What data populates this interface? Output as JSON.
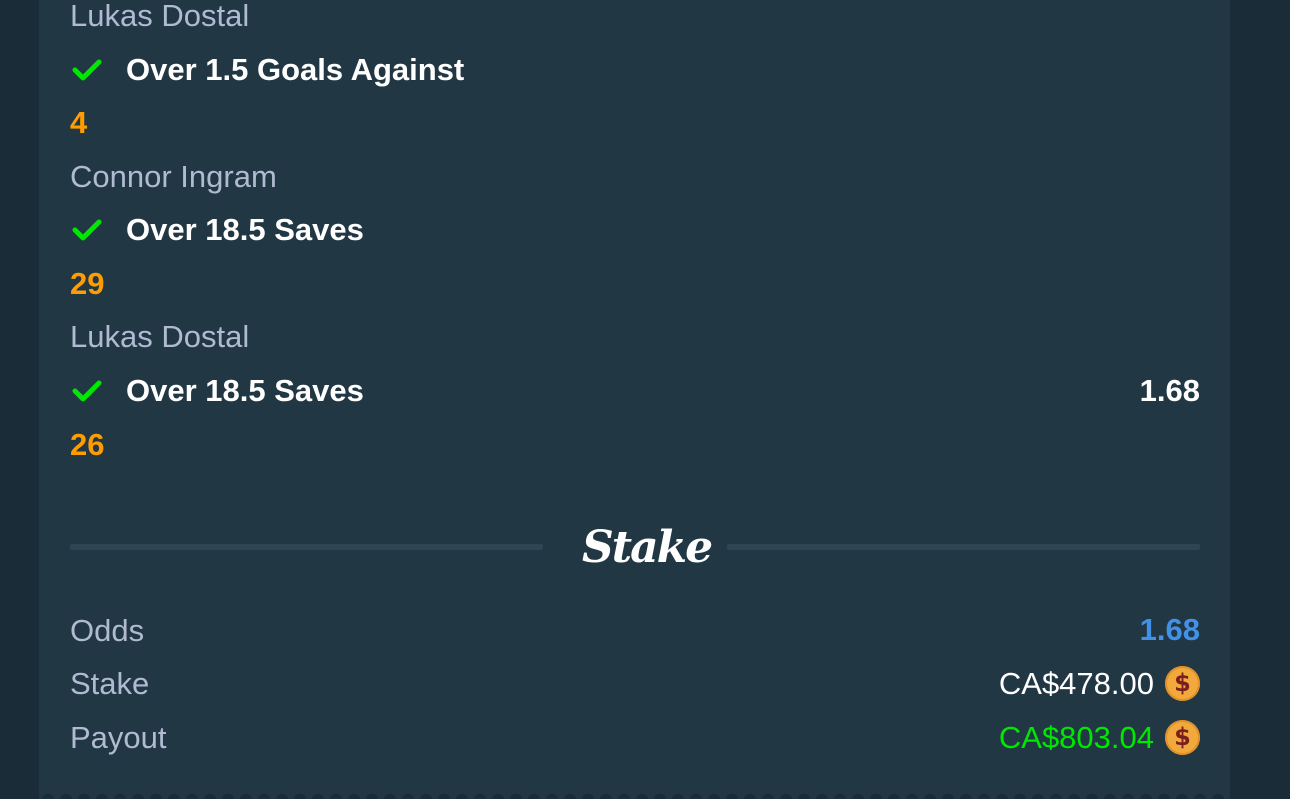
{
  "legs": [
    {
      "market": "Over 1.5 Goals Against",
      "result": "4",
      "player_prev": "Lukas Dostal"
    },
    {
      "player": "Connor Ingram",
      "market": "Over 18.5 Saves",
      "result": "29"
    },
    {
      "player": "Lukas Dostal",
      "market": "Over 18.5 Saves",
      "odds": "1.68",
      "result": "26"
    }
  ],
  "brand": {
    "logo_text": "Stake"
  },
  "summary": {
    "odds_label": "Odds",
    "odds_value": "1.68",
    "stake_label": "Stake",
    "stake_value": "CA$478.00",
    "payout_label": "Payout",
    "payout_value": "CA$803.04",
    "currency_symbol": "$"
  },
  "colors": {
    "background": "#1a2c38",
    "card": "#213743",
    "win_check": "#00e701",
    "result": "#ff9d00",
    "odds_total": "#4391e7",
    "payout": "#00e701",
    "coin": "#f2a93b"
  },
  "icons": {
    "leg_status": "check-icon",
    "currency": "cad-coin-icon"
  }
}
